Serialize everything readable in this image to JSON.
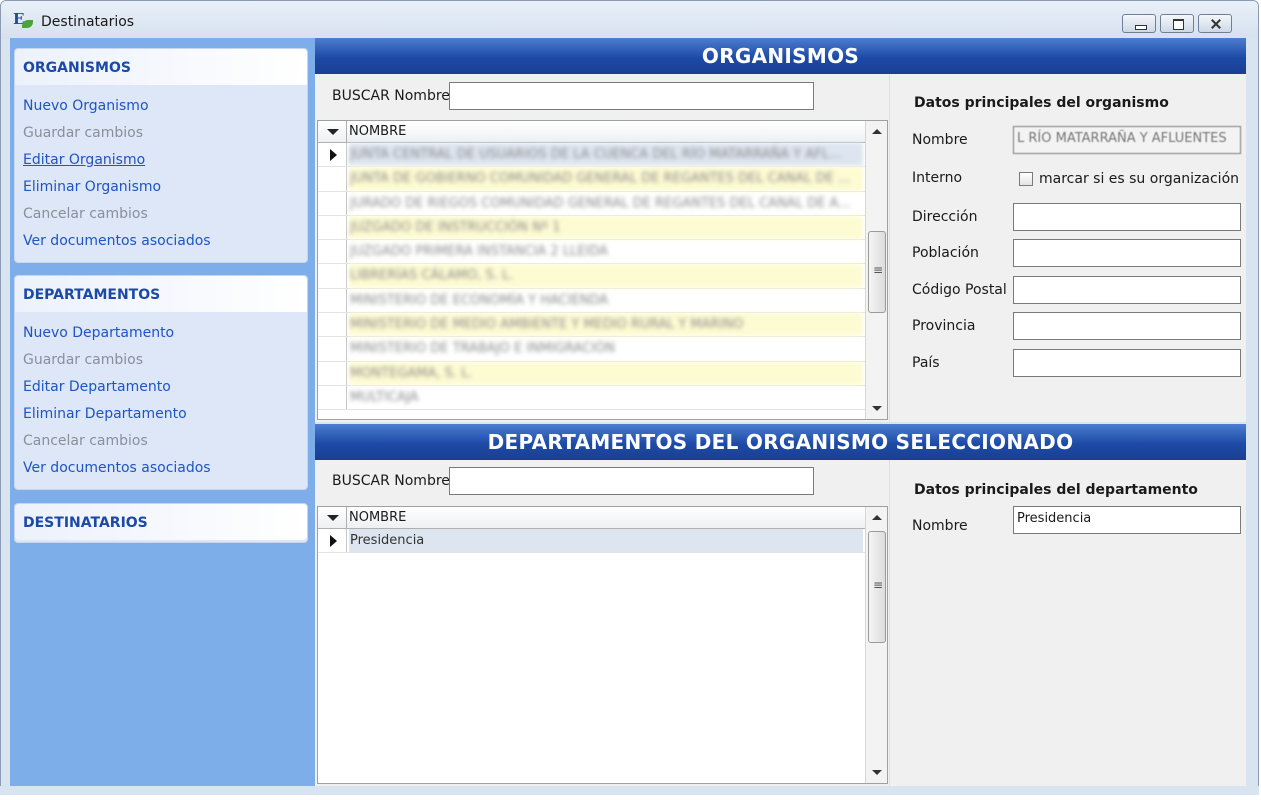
{
  "window": {
    "title": "Destinatarios",
    "app_icon_letter": "E"
  },
  "sidebar": {
    "organismos": {
      "header": "ORGANISMOS",
      "items": [
        {
          "label": "Nuevo Organismo",
          "enabled": true
        },
        {
          "label": "Guardar cambios",
          "enabled": false
        },
        {
          "label": "Editar Organismo",
          "enabled": true
        },
        {
          "label": "Eliminar Organismo",
          "enabled": true
        },
        {
          "label": "Cancelar cambios",
          "enabled": false
        },
        {
          "label": "Ver documentos asociados",
          "enabled": true
        }
      ]
    },
    "departamentos": {
      "header": "DEPARTAMENTOS",
      "items": [
        {
          "label": "Nuevo Departamento",
          "enabled": true
        },
        {
          "label": "Guardar cambios",
          "enabled": false
        },
        {
          "label": "Editar Departamento",
          "enabled": true
        },
        {
          "label": "Eliminar Departamento",
          "enabled": true
        },
        {
          "label": "Cancelar cambios",
          "enabled": false
        },
        {
          "label": "Ver documentos asociados",
          "enabled": true
        }
      ]
    },
    "destinatarios": {
      "header": "DESTINATARIOS"
    }
  },
  "organismos": {
    "title": "ORGANISMOS",
    "search_label": "BUSCAR Nombre",
    "search_value": "",
    "grid": {
      "column": "NOMBRE",
      "rows": [
        "JUNTA CENTRAL DE USUARIOS DE LA CUENCA DEL RÍO MATARRAÑA Y AFL...",
        "JUNTA DE GOBIERNO COMUNIDAD GENERAL DE REGANTES DEL CANAL DE ...",
        "JURADO DE RIEGOS COMUNIDAD GENERAL DE REGANTES DEL CANAL DE A...",
        "JUZGADO DE INSTRUCCIÓN Nº 1",
        "JUZGADO PRIMERA INSTANCIA 2 LLEIDA",
        "LIBRERÍAS CÁLAMO, S. L.",
        "MINISTERIO DE ECONOMÍA Y HACIENDA",
        "MINISTERIO DE MEDIO AMBIENTE Y MEDIO RURAL Y MARINO",
        "MINISTERIO DE TRABAJO E INMIGRACIÓN",
        "MONTEGAMA, S. L.",
        "MULTICAJA"
      ]
    },
    "detail": {
      "title": "Datos principales del organismo",
      "fields": {
        "nombre_label": "Nombre",
        "nombre_value": "L RÍO MATARRAÑA Y AFLUENTES",
        "interno_label": "Interno",
        "interno_check_label": "marcar si es su organización",
        "direccion_label": "Dirección",
        "direccion_value": "",
        "poblacion_label": "Población",
        "poblacion_value": "",
        "cp_label": "Código Postal",
        "cp_value": "",
        "provincia_label": "Provincia",
        "provincia_value": "",
        "pais_label": "País",
        "pais_value": ""
      }
    }
  },
  "departamentos": {
    "title": "DEPARTAMENTOS DEL ORGANISMO SELECCIONADO",
    "search_label": "BUSCAR Nombre",
    "search_value": "",
    "grid": {
      "column": "NOMBRE",
      "rows": [
        "Presidencia"
      ]
    },
    "detail": {
      "title": "Datos principales del departamento",
      "nombre_label": "Nombre",
      "nombre_value": "Presidencia"
    }
  }
}
